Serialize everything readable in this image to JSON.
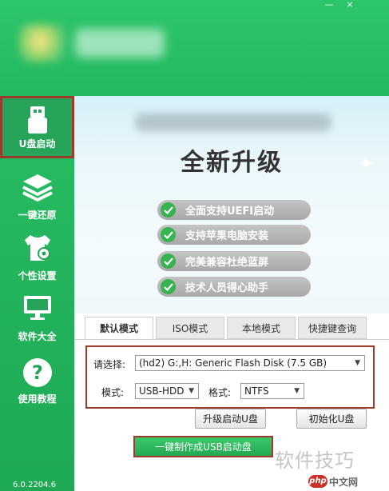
{
  "window": {
    "minimize": "—",
    "close": "×"
  },
  "sidebar": {
    "items": [
      {
        "label": "U盘启动",
        "icon": "usb-drive-icon",
        "active": true
      },
      {
        "label": "一键还原",
        "icon": "layers-icon",
        "active": false
      },
      {
        "label": "个性设置",
        "icon": "tshirt-gear-icon",
        "active": false
      },
      {
        "label": "软件大全",
        "icon": "monitor-icon",
        "active": false
      },
      {
        "label": "使用教程",
        "icon": "help-circle-icon",
        "active": false
      }
    ],
    "version": "6.0.2204.6"
  },
  "banner": {
    "headline": "全新升级",
    "features": [
      "全面支持UEFI启动",
      "支持苹果电脑安装",
      "完美兼容杜绝蓝屏",
      "技术人员得心助手"
    ]
  },
  "tabs": [
    {
      "label": "默认模式",
      "active": true
    },
    {
      "label": "ISO模式",
      "active": false
    },
    {
      "label": "本地模式",
      "active": false
    },
    {
      "label": "快捷键查询",
      "active": false
    }
  ],
  "form": {
    "select_label": "请选择:",
    "disk_value": "(hd2) G:,H: Generic Flash Disk (7.5 GB)",
    "mode_label": "模式:",
    "mode_value": "USB-HDD",
    "format_label": "格式:",
    "format_value": "NTFS"
  },
  "buttons": {
    "upgrade": "升级启动U盘",
    "init": "初始化U盘",
    "make": "一键制作成USB启动盘"
  },
  "watermarks": {
    "text1": "软件技巧",
    "badge": "php",
    "text2": "中文网"
  },
  "colors": {
    "brand_green": "#27bd62",
    "highlight_red": "#9a3b2e",
    "check_green": "#36b44f"
  }
}
